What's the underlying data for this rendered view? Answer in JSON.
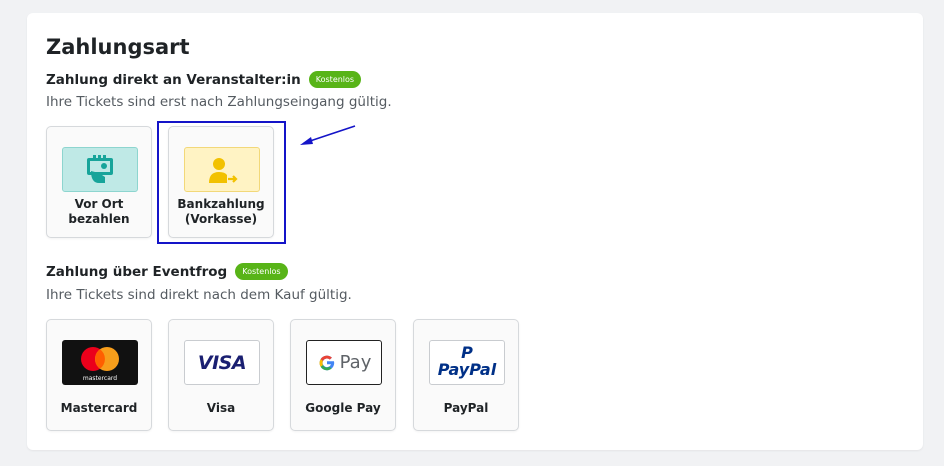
{
  "title": "Zahlungsart",
  "sections": [
    {
      "heading": "Zahlung direkt an Veranstalter:in",
      "badge": "Kostenlos",
      "description": "Ihre Tickets sind erst nach Zahlungseingang gültig.",
      "options": [
        {
          "label": "Vor Ort\nbezahlen",
          "icon": "pay-on-site-icon"
        },
        {
          "label": "Bankzahlung\n(Vorkasse)",
          "icon": "bank-transfer-icon"
        }
      ]
    },
    {
      "heading": "Zahlung über Eventfrog",
      "badge": "Kostenlos",
      "description": "Ihre Tickets sind direkt nach dem Kauf gültig.",
      "options": [
        {
          "label": "Mastercard",
          "icon": "mastercard-icon",
          "logo_text": "mastercard"
        },
        {
          "label": "Visa",
          "icon": "visa-icon",
          "logo_text": "VISA"
        },
        {
          "label": "Google Pay",
          "icon": "google-pay-icon",
          "logo_text": "Pay"
        },
        {
          "label": "PayPal",
          "icon": "paypal-icon",
          "logo_text": "PayPal"
        }
      ]
    }
  ],
  "colors": {
    "badge": "#58b418",
    "highlight": "#1414c8",
    "on_site_bg": "#bfe9e6",
    "bank_bg": "#fff3c4"
  }
}
